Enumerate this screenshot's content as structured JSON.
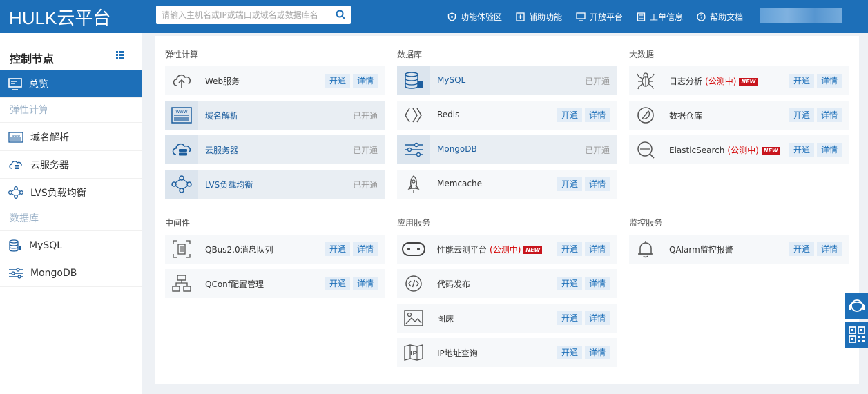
{
  "header": {
    "logo": "HULK云平台",
    "search_placeholder": "请输入主机名或IP或端口或域名或数据库名",
    "nav": [
      "功能体验区",
      "辅助功能",
      "开放平台",
      "工单信息",
      "帮助文档"
    ]
  },
  "sidebar": {
    "title": "控制节点",
    "overview": "总览",
    "cat_compute": "弹性计算",
    "compute_items": [
      "域名解析",
      "云服务器",
      "LVS负载均衡"
    ],
    "cat_db": "数据库",
    "db_items": [
      "MySQL",
      "MongoDB"
    ]
  },
  "labels": {
    "open": "开通",
    "detail": "详情",
    "opened": "已开通",
    "beta": "(公测中)",
    "new": "NEW"
  },
  "sections": {
    "compute": {
      "title": "弹性计算",
      "items": [
        "Web服务",
        "域名解析",
        "云服务器",
        "LVS负载均衡"
      ]
    },
    "database": {
      "title": "数据库",
      "items": [
        "MySQL",
        "Redis",
        "MongoDB",
        "Memcache"
      ]
    },
    "bigdata": {
      "title": "大数据",
      "items": [
        "日志分析",
        "数据仓库",
        "ElasticSearch"
      ]
    },
    "middleware": {
      "title": "中间件",
      "items": [
        "QBus2.0消息队列",
        "QConf配置管理"
      ]
    },
    "appservice": {
      "title": "应用服务",
      "items": [
        "性能云测平台",
        "代码发布",
        "图床",
        "IP地址查询"
      ]
    },
    "monitor": {
      "title": "监控服务",
      "items": [
        "QAlarm监控报警"
      ]
    }
  },
  "colors": {
    "brand": "#1d6fb8",
    "beta": "#d40000",
    "new_badge": "#c8151d"
  }
}
